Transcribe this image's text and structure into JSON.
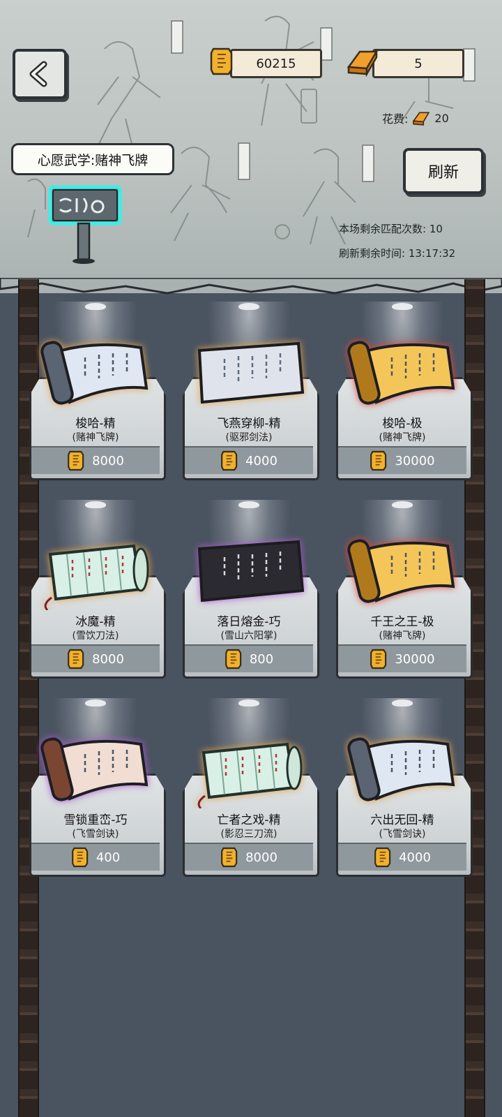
{
  "header": {
    "back_icon": "chevron-left-icon",
    "coins": "60215",
    "gold": "5",
    "cost_label": "花费:",
    "cost_value": "20",
    "wish": "心愿武学:赌神飞牌",
    "refresh_label": "刷新",
    "matches_label": "本场剩余匹配次数:",
    "matches_value": "10",
    "time_label": "刷新剩余时间:",
    "time_value": "13:17:32"
  },
  "items": [
    {
      "name": "梭哈-精",
      "school": "(赌神飞牌)",
      "price": "8000",
      "art": "scroll-grey",
      "glow": "#e6a44a"
    },
    {
      "name": "飞燕穿柳-精",
      "school": "(驱邪剑法)",
      "price": "4000",
      "art": "tablet-silver",
      "glow": "#e6a44a"
    },
    {
      "name": "梭哈-极",
      "school": "(赌神飞牌)",
      "price": "30000",
      "art": "scroll-gold",
      "glow": "#e0483a"
    },
    {
      "name": "冰魔-精",
      "school": "(雪饮刀法)",
      "price": "8000",
      "art": "bamboo-green",
      "glow": "#e6a44a"
    },
    {
      "name": "落日熔金-巧",
      "school": "(雪山六阳掌)",
      "price": "800",
      "art": "tablet-black",
      "glow": "#b05ad8"
    },
    {
      "name": "千王之王-极",
      "school": "(赌神飞牌)",
      "price": "30000",
      "art": "scroll-gold",
      "glow": "#e0483a"
    },
    {
      "name": "雪锁重峦-巧",
      "school": "(飞雪剑诀)",
      "price": "400",
      "art": "scroll-brown",
      "glow": "#b05ad8"
    },
    {
      "name": "亡者之戏-精",
      "school": "(影忍三刀流)",
      "price": "8000",
      "art": "bamboo-green",
      "glow": "#e6a44a"
    },
    {
      "name": "六出无回-精",
      "school": "(飞雪剑诀)",
      "price": "4000",
      "art": "scroll-grey",
      "glow": "#e6a44a"
    }
  ]
}
